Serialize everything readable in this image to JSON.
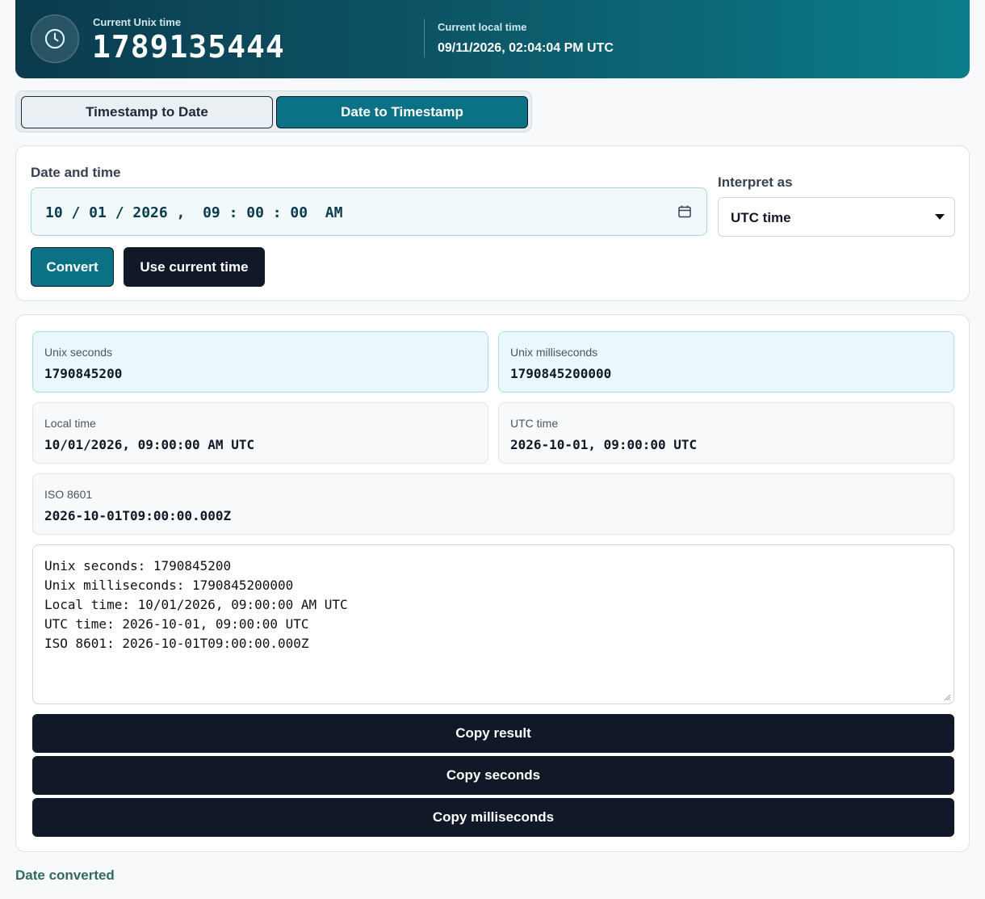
{
  "header": {
    "unix_label": "Current Unix time",
    "unix_value": "1789135444",
    "local_label": "Current local time",
    "local_value": "09/11/2026, 02:04:04 PM UTC"
  },
  "tabs": [
    {
      "label": "Timestamp to Date",
      "active": false
    },
    {
      "label": "Date to Timestamp",
      "active": true
    }
  ],
  "form": {
    "datetime_label": "Date and time",
    "datetime_value": "10 / 01 / 2026 ,  09 : 00 : 00  AM",
    "interpret_label": "Interpret as",
    "interpret_value": "UTC time",
    "convert_label": "Convert",
    "now_label": "Use current time"
  },
  "results": {
    "unix_seconds": {
      "label": "Unix seconds",
      "value": "1790845200"
    },
    "unix_ms": {
      "label": "Unix milliseconds",
      "value": "1790845200000"
    },
    "local": {
      "label": "Local time",
      "value": "10/01/2026, 09:00:00 AM UTC"
    },
    "utc": {
      "label": "UTC time",
      "value": "2026-10-01, 09:00:00 UTC"
    },
    "iso": {
      "label": "ISO 8601",
      "value": "2026-10-01T09:00:00.000Z"
    }
  },
  "summary_lines": [
    "Unix seconds: 1790845200",
    "Unix milliseconds: 1790845200000",
    "Local time: 10/01/2026, 09:00:00 AM UTC",
    "UTC time: 2026-10-01, 09:00:00 UTC",
    "ISO 8601: 2026-10-01T09:00:00.000Z"
  ],
  "actions": {
    "copy_result": "Copy result",
    "copy_seconds": "Copy seconds",
    "copy_ms": "Copy milliseconds"
  },
  "status": "Date converted",
  "colors": {
    "accent": "#0b7285",
    "dark_button": "#111827",
    "status_text": "#2f6b5e"
  }
}
